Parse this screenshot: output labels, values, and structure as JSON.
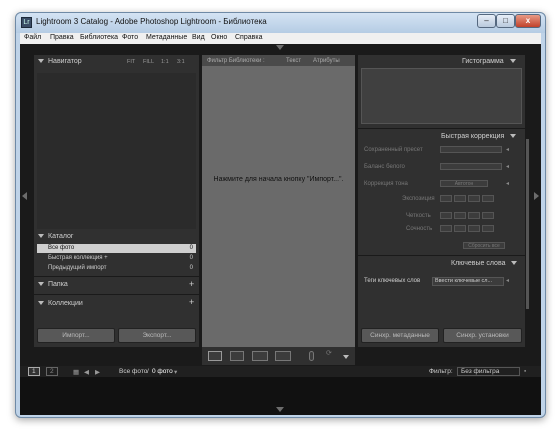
{
  "window": {
    "title": "Lightroom 3 Catalog - Adobe Photoshop Lightroom - Библиотека",
    "icon": "Lr",
    "min": "–",
    "max": "□",
    "close": "x"
  },
  "menu": [
    "Файл",
    "Правка",
    "Библиотека",
    "Фото",
    "Метаданные",
    "Вид",
    "Окно",
    "Справка"
  ],
  "left": {
    "navigator": {
      "title": "Навигатор",
      "zoom": [
        "FIT",
        "FILL",
        "1:1",
        "3:1"
      ]
    },
    "catalog": {
      "title": "Каталог",
      "items": [
        {
          "label": "Все фото",
          "count": "0"
        },
        {
          "label": "Быстрая коллекция +",
          "count": "0"
        },
        {
          "label": "Предыдущий импорт",
          "count": "0"
        }
      ]
    },
    "folders": {
      "title": "Папка",
      "add": "+"
    },
    "collections": {
      "title": "Коллекции",
      "add": "+"
    },
    "import_button": "Импорт...",
    "export_button": "Экспорт..."
  },
  "center": {
    "tabs": [
      "Фильтр Библиотеки :",
      "Текст",
      "Атрибуты"
    ],
    "message": "Нажмите для начала кнопку \"Импорт...\"."
  },
  "right": {
    "histogram": {
      "title": "Гистограмма"
    },
    "quick": {
      "title": "Быстрая коррекция",
      "rows": [
        "Сохраненный пресет",
        "Баланс белого",
        "Коррекция тона",
        "Экспозиция",
        "Четкость",
        "Сочность"
      ],
      "auto_tone": "Автотон",
      "reset": "Сбросить все"
    },
    "keywords": {
      "title": "Ключевые слова",
      "label": "Теги ключевых слов",
      "value": "Ввести ключевые сл..."
    },
    "sync_meta": "Синхр. метаданные",
    "sync_settings": "Синхр. установки"
  },
  "filmstrip": {
    "page1": "1",
    "page2": "2",
    "source": "Все фото",
    "count": "0 фото",
    "filter_label": "Фильтр:",
    "filter_value": "Без фильтра"
  }
}
